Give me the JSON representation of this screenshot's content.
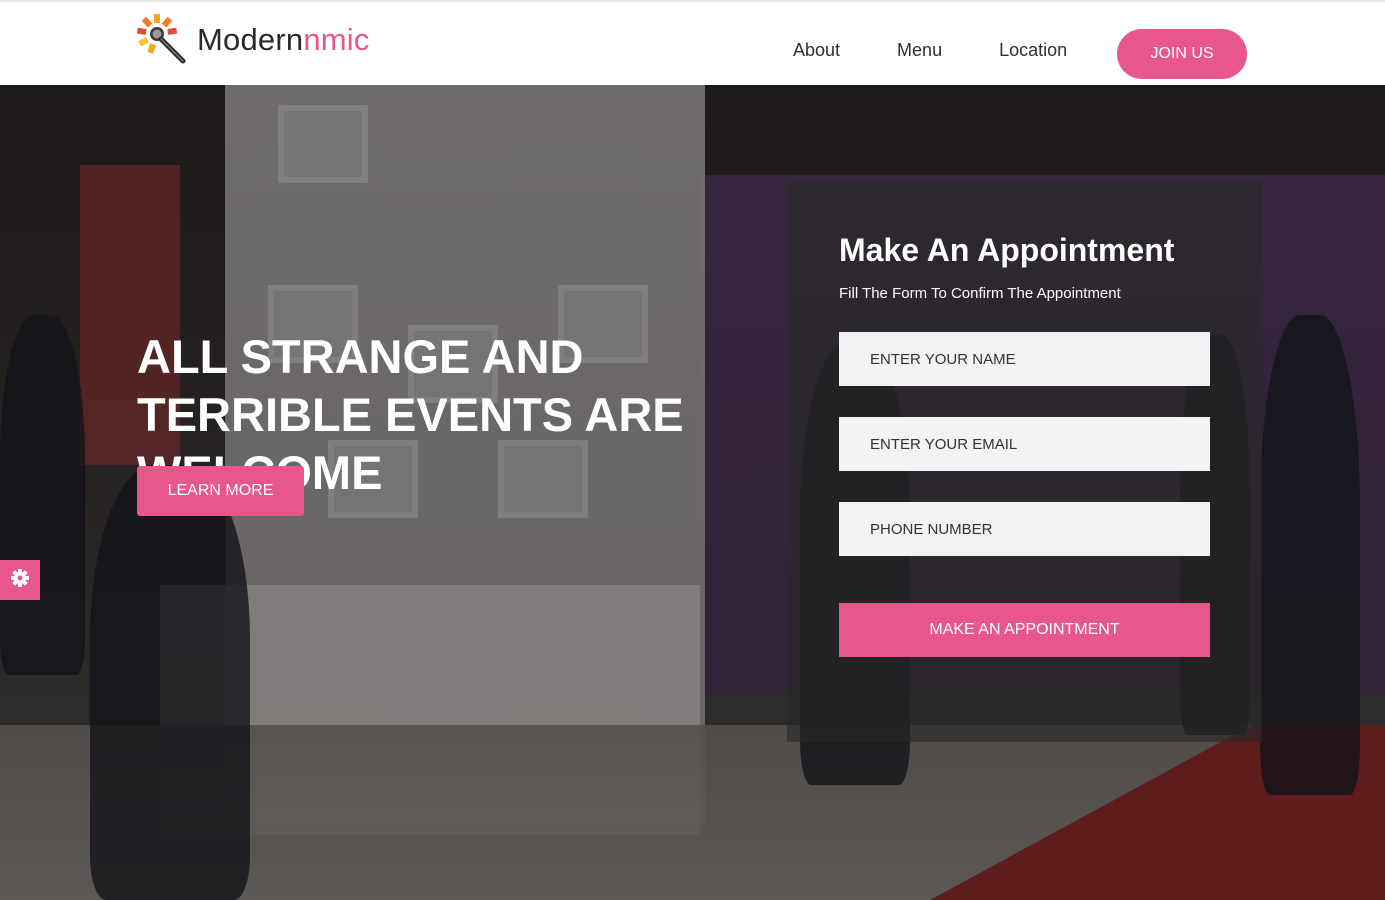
{
  "brand": {
    "name_primary": "Modern",
    "name_accent": "nmic",
    "accent_color": "#e7578c"
  },
  "nav": {
    "items": [
      {
        "label": "About"
      },
      {
        "label": "Menu"
      },
      {
        "label": "Location"
      }
    ],
    "join_label": "JOIN US"
  },
  "hero": {
    "title": "ALL STRANGE AND TERRIBLE EVENTS ARE WELCOME",
    "cta_label": "LEARN MORE"
  },
  "appointment": {
    "title": "Make An Appointment",
    "subtitle": "Fill The Form To Confirm The Appointment",
    "name_placeholder": "ENTER YOUR NAME",
    "email_placeholder": "ENTER YOUR EMAIL",
    "phone_placeholder": "PHONE NUMBER",
    "submit_label": "MAKE AN APPOINTMENT"
  },
  "icons": {
    "logo": "microphone-icon",
    "settings": "gear-icon"
  }
}
